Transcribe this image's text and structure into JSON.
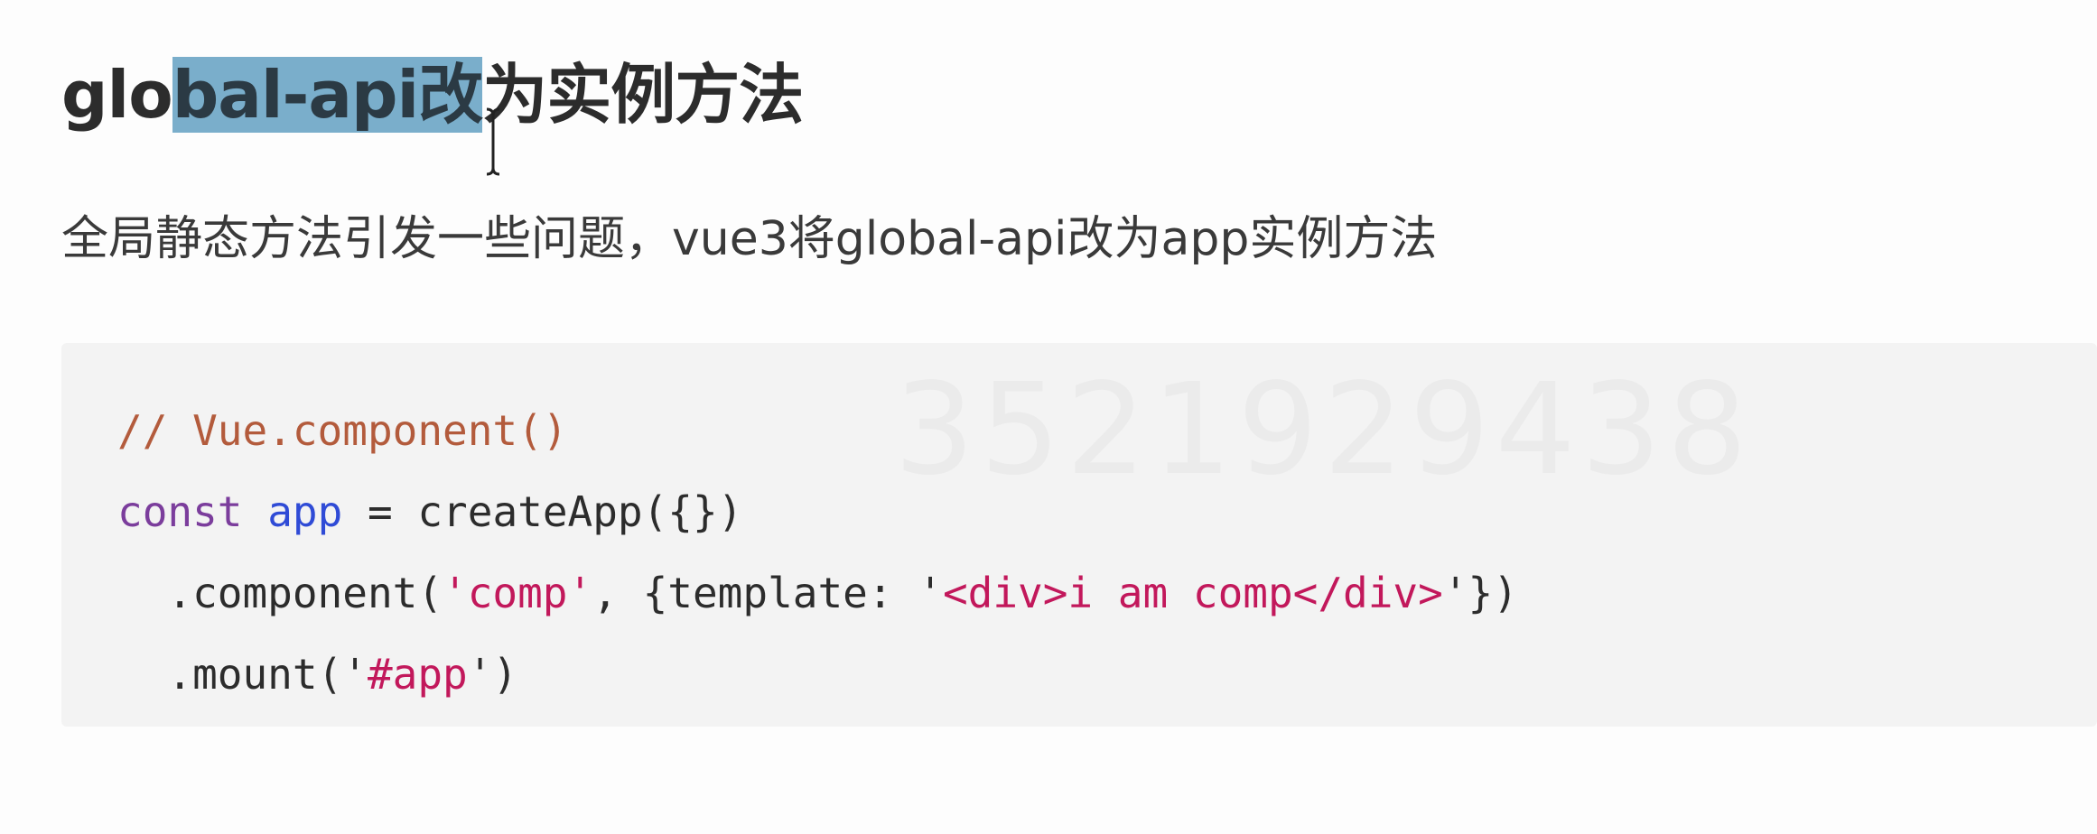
{
  "heading": {
    "before": "glo",
    "selected": "bal-api改",
    "after": "为实例方法"
  },
  "description": "全局静态方法引发一些问题，vue3将global-api改为app实例方法",
  "watermark": "3521929438",
  "code": {
    "line1": {
      "comment": "// Vue.component()"
    },
    "line2": {
      "keyword": "const",
      "var": "app",
      "rest": " = createApp({})"
    },
    "line3": {
      "p1": "  .component(",
      "s1": "'comp'",
      "p2": ", {template: ",
      "q1": "'",
      "s2": "<div>i am comp</div>",
      "q2": "'",
      "p3": "})"
    },
    "line4": {
      "p1": "  .mount(",
      "q1": "'",
      "s1": "#app",
      "q2": "'",
      "p2": ")"
    }
  },
  "colors": {
    "selection": "#7aaecb",
    "comment": "#b35b3c",
    "keyword": "#7b3d9c",
    "variable": "#2f4bd6",
    "string": "#c2185b",
    "code_background": "#f3f3f3"
  },
  "icons": {
    "cursor": "text-cursor-icon"
  }
}
